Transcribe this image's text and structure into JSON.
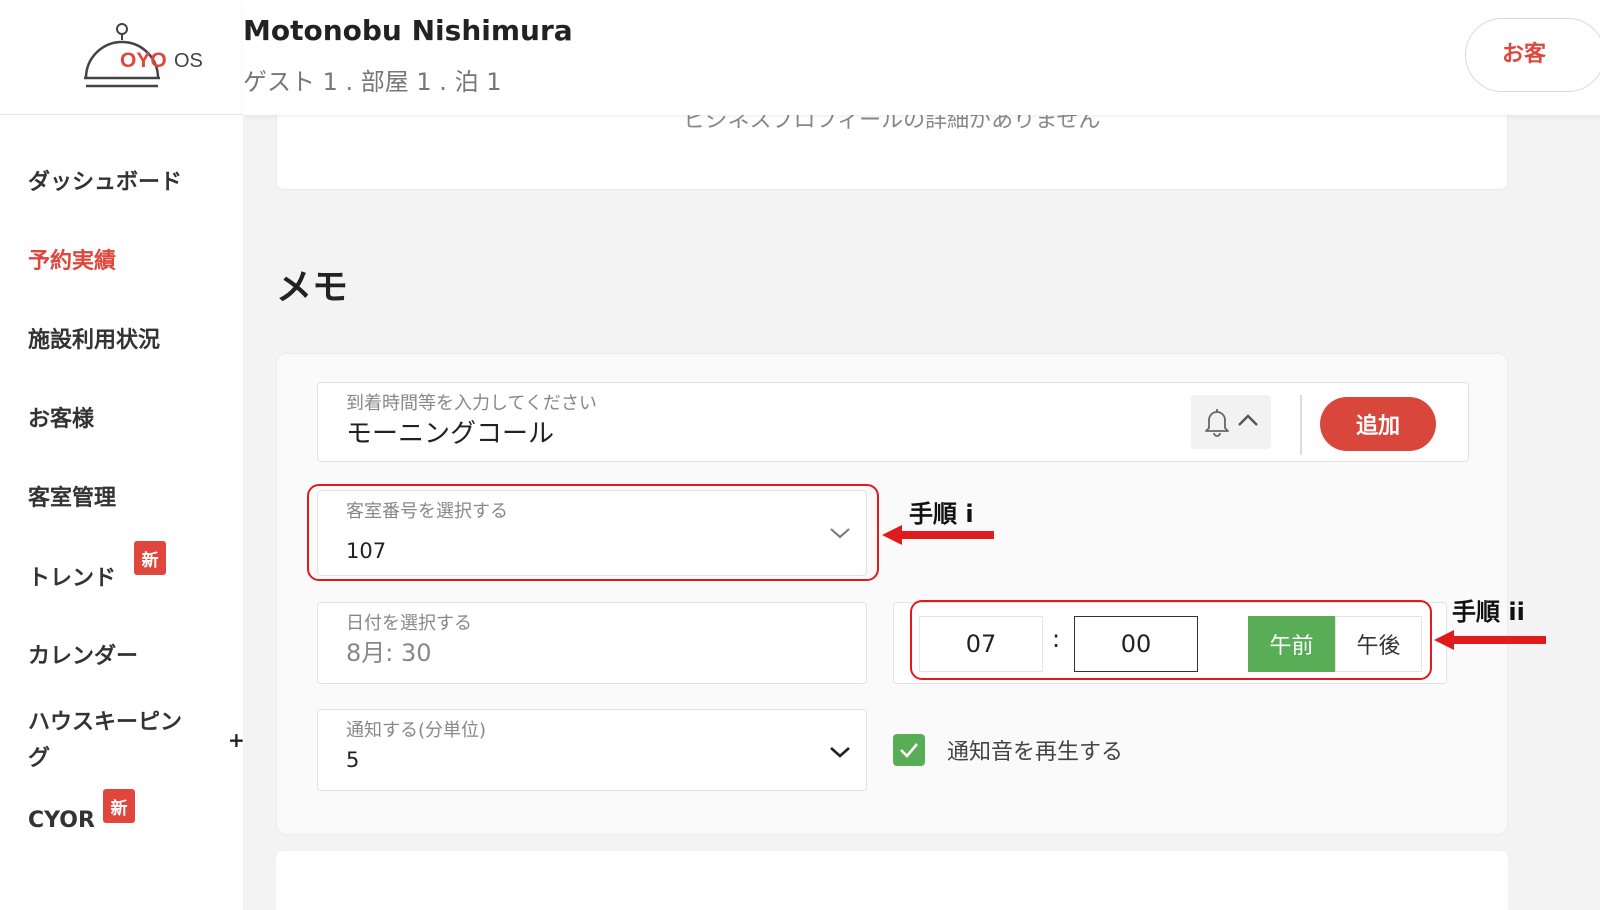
{
  "brand": {
    "logo_text": "OYO",
    "logo_suffix": "OS",
    "accent": "#e0463c"
  },
  "header": {
    "guest_name": "Motonobu Nishimura",
    "guest_summary": "ゲスト 1 . 部屋 1 . 泊 1",
    "right_button": "お客"
  },
  "sidebar": {
    "items": [
      {
        "label": "ダッシュボード"
      },
      {
        "label": "予約実績",
        "active": true
      },
      {
        "label": "施設利用状況"
      },
      {
        "label": "お客様"
      },
      {
        "label": "客室管理"
      },
      {
        "label": "トレンド",
        "badge": "新"
      },
      {
        "label": "カレンダー"
      },
      {
        "label": "ハウスキーピン"
      },
      {
        "label": "グ"
      },
      {
        "label": "CYOR",
        "badge": "新"
      }
    ],
    "expand_symbol": "+"
  },
  "profile_card": {
    "text": "ビジネスプロフィールの詳細がありません"
  },
  "memo": {
    "title": "メモ",
    "input_label": "到着時間等を入力してください",
    "input_value": "モーニングコール",
    "add_button": "追加",
    "room_label": "客室番号を選択する",
    "room_value": "107",
    "date_label": "日付を選択する",
    "date_value": "8月: 30",
    "hour": "07",
    "colon": ":",
    "minute": "00",
    "am_label": "午前",
    "pm_label": "午後",
    "am_selected": true,
    "notify_label": "通知する(分単位)",
    "notify_value": "5",
    "sound_label": "通知音を再生する",
    "sound_checked": true
  },
  "annotations": {
    "step1": "手順 i",
    "step2": "手順 ii",
    "color": "#e11b1b"
  }
}
